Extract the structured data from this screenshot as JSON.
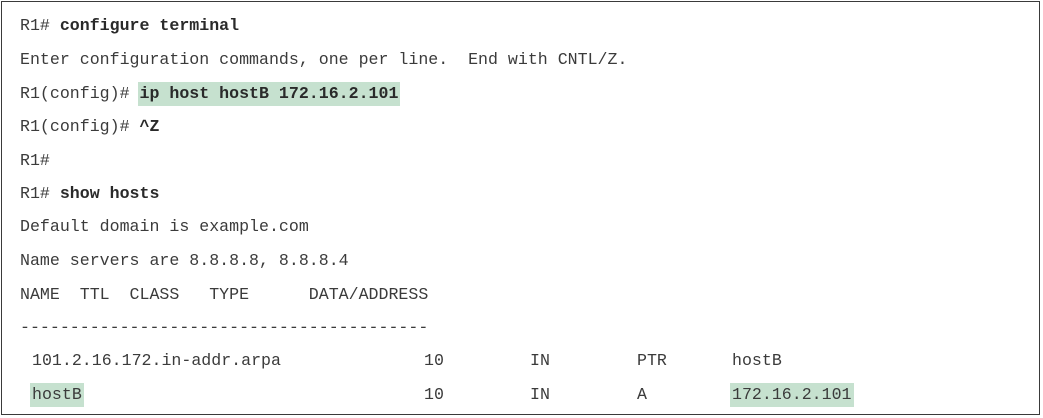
{
  "session": {
    "line1": {
      "prompt": "R1# ",
      "command": "configure terminal"
    },
    "line2": "Enter configuration commands, one per line.  End with CNTL/Z.",
    "line3": {
      "prompt": "R1(config)# ",
      "command": "ip host hostB 172.16.2.101"
    },
    "line4": {
      "prompt": "R1(config)# ",
      "command": "^Z"
    },
    "line5": "R1#",
    "line6": {
      "prompt": "R1# ",
      "command": "show hosts"
    },
    "line7": "Default domain is example.com",
    "line8": "Name servers are 8.8.8.8, 8.8.8.4",
    "line9": "NAME  TTL  CLASS   TYPE      DATA/ADDRESS",
    "line10": "-----------------------------------------"
  },
  "host_table": {
    "rows": [
      {
        "name": "101.2.16.172.in-addr.arpa",
        "ttl": "10",
        "class": "IN",
        "type": "PTR",
        "data": "hostB",
        "highlighted": false
      },
      {
        "name": "hostB",
        "ttl": "10",
        "class": "IN",
        "type": "A",
        "data": "172.16.2.101",
        "highlighted": true
      }
    ]
  },
  "colors": {
    "highlight": "#c6e1cf",
    "text": "#3b3b3b",
    "border": "#3a3a3a"
  }
}
